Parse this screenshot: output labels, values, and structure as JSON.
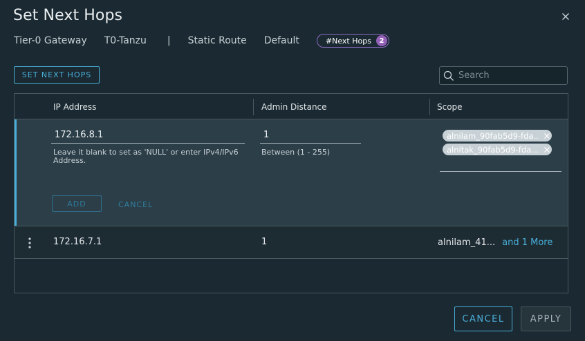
{
  "dialog": {
    "title": "Set Next Hops",
    "close_icon": "close-icon"
  },
  "breadcrumb": {
    "gateway_label": "Tier-0 Gateway",
    "gateway_name": "T0-Tanzu",
    "separator": "|",
    "route_label": "Static Route",
    "route_name": "Default",
    "hops_label": "#Next Hops",
    "hops_count": "2"
  },
  "toolbar": {
    "set_button_label": "SET NEXT HOPS",
    "search_placeholder": "Search",
    "search_icon": "search-icon"
  },
  "grid": {
    "columns": [
      "IP Address",
      "Admin Distance",
      "Scope"
    ],
    "edit_row": {
      "ip_value": "172.16.8.1",
      "ip_helper": "Leave it blank to set as 'NULL' or enter IPv4/IPv6 Address.",
      "distance_value": "1",
      "distance_helper": "Between (1 - 255)",
      "scope_chips": [
        "alnilam_90fab5d9-fda...",
        "alnitak_90fab5d9-fda..."
      ],
      "add_label": "ADD",
      "cancel_label": "CANCEL"
    },
    "rows": [
      {
        "ip": "172.16.7.1",
        "distance": "1",
        "scope": "alnilam_41...",
        "more": "and 1 More"
      }
    ]
  },
  "footer": {
    "cancel_label": "CANCEL",
    "apply_label": "APPLY"
  },
  "colors": {
    "accent": "#49afd9",
    "badge": "#9460b8",
    "background": "#1b2a32",
    "edit_row": "#2c3e48"
  }
}
